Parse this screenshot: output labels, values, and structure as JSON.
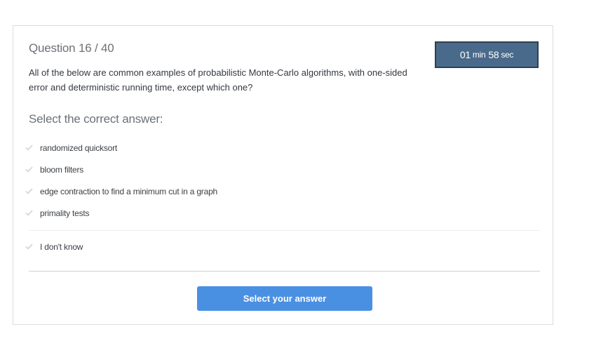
{
  "question": {
    "title": "Question 16 / 40",
    "text": "All of the below are common examples of probabilistic Monte-Carlo algorithms, with one-sided error and deterministic running time, except which one?"
  },
  "timer": {
    "minutes": "01",
    "minutes_unit": "min",
    "seconds": "58",
    "seconds_unit": "sec"
  },
  "answers": {
    "prompt": "Select the correct answer:",
    "options": [
      {
        "label": "randomized quicksort"
      },
      {
        "label": "bloom filters"
      },
      {
        "label": "edge contraction to find a minimum cut in a graph"
      },
      {
        "label": "primality tests"
      }
    ],
    "dont_know": "I don't know"
  },
  "submit": {
    "label": "Select your answer"
  },
  "colors": {
    "timer_bg": "#4a6a8b",
    "button_bg": "#4a90e2",
    "check_icon": "#d9d9d9"
  },
  "icons": {
    "option_marker": "checkmark-icon"
  }
}
